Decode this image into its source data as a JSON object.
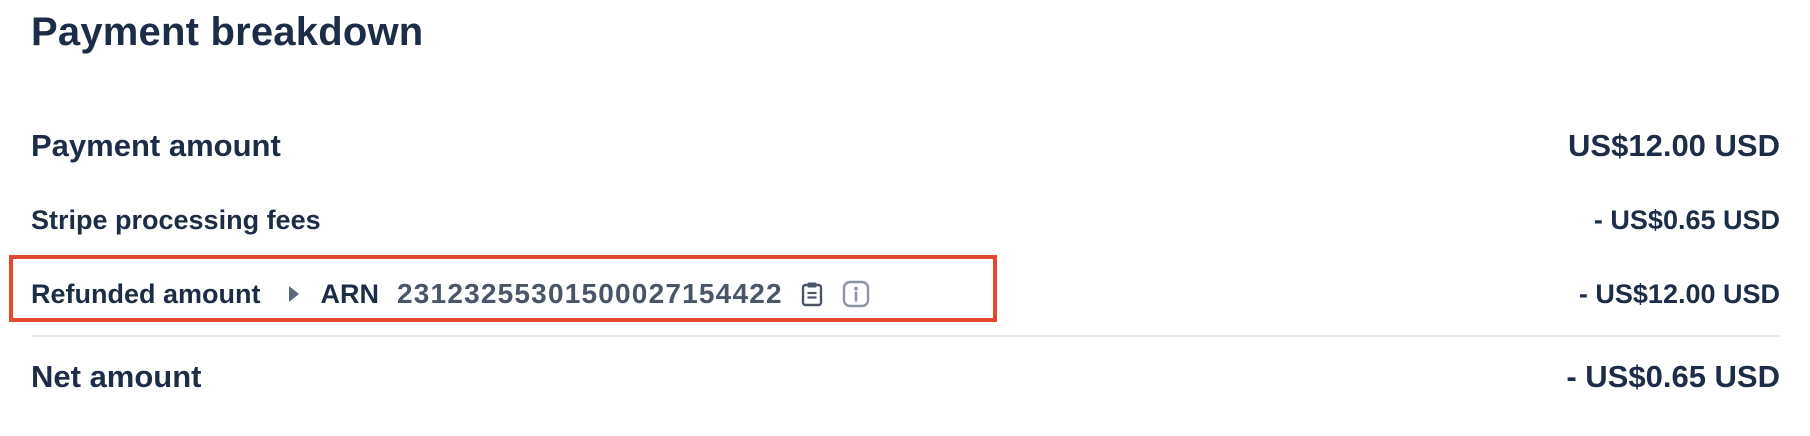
{
  "title": "Payment breakdown",
  "rows": {
    "payment": {
      "label": "Payment amount",
      "amount": "US$12.00 USD"
    },
    "fees": {
      "label": "Stripe processing fees",
      "amount": "- US$0.65 USD"
    },
    "refund": {
      "label": "Refunded amount",
      "arn_label": "ARN",
      "arn_value": "23123255301500027154422",
      "amount": "- US$12.00 USD"
    },
    "net": {
      "label": "Net amount",
      "amount": "- US$0.65 USD"
    }
  },
  "icons": {
    "expand": "caret-right-icon",
    "copy": "clipboard-icon",
    "info": "info-icon"
  },
  "colors": {
    "text": "#1e2d47",
    "muted": "#4a5568",
    "highlight": "#e14a2f",
    "divider": "#e7eaef"
  }
}
